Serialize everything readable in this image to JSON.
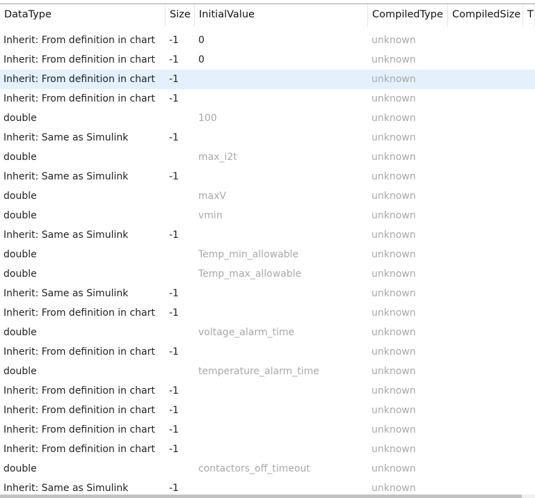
{
  "columns": [
    "DataType",
    "Size",
    "InitialValue",
    "CompiledType",
    "CompiledSize",
    "T"
  ],
  "selected_row": 2,
  "rows": [
    {
      "datatype": "Inherit: From definition in chart",
      "size": "-1",
      "initial": "0",
      "initial_grey": false,
      "compiled": "unknown"
    },
    {
      "datatype": "Inherit: From definition in chart",
      "size": "-1",
      "initial": "0",
      "initial_grey": false,
      "compiled": "unknown"
    },
    {
      "datatype": "Inherit: From definition in chart",
      "size": "-1",
      "initial": "",
      "compiled": "unknown"
    },
    {
      "datatype": "Inherit: From definition in chart",
      "size": "-1",
      "initial": "",
      "compiled": "unknown"
    },
    {
      "datatype": "double",
      "size": "",
      "initial": "100",
      "initial_grey": true,
      "compiled": "unknown"
    },
    {
      "datatype": "Inherit: Same as Simulink",
      "size": "-1",
      "initial": "",
      "compiled": "unknown"
    },
    {
      "datatype": "double",
      "size": "",
      "initial": "max_i2t",
      "initial_grey": true,
      "compiled": "unknown"
    },
    {
      "datatype": "Inherit: Same as Simulink",
      "size": "-1",
      "initial": "",
      "compiled": "unknown"
    },
    {
      "datatype": "double",
      "size": "",
      "initial": "maxV",
      "initial_grey": true,
      "compiled": "unknown"
    },
    {
      "datatype": "double",
      "size": "",
      "initial": "vmin",
      "initial_grey": true,
      "compiled": "unknown"
    },
    {
      "datatype": "Inherit: Same as Simulink",
      "size": "-1",
      "initial": "",
      "compiled": "unknown"
    },
    {
      "datatype": "double",
      "size": "",
      "initial": "Temp_min_allowable",
      "initial_grey": true,
      "compiled": "unknown"
    },
    {
      "datatype": "double",
      "size": "",
      "initial": "Temp_max_allowable",
      "initial_grey": true,
      "compiled": "unknown"
    },
    {
      "datatype": "Inherit: Same as Simulink",
      "size": "-1",
      "initial": "",
      "compiled": "unknown"
    },
    {
      "datatype": "Inherit: From definition in chart",
      "size": "-1",
      "initial": "",
      "compiled": "unknown"
    },
    {
      "datatype": "double",
      "size": "",
      "initial": "voltage_alarm_time",
      "initial_grey": true,
      "compiled": "unknown"
    },
    {
      "datatype": "Inherit: From definition in chart",
      "size": "-1",
      "initial": "",
      "compiled": "unknown"
    },
    {
      "datatype": "double",
      "size": "",
      "initial": "temperature_alarm_time",
      "initial_grey": true,
      "compiled": "unknown"
    },
    {
      "datatype": "Inherit: From definition in chart",
      "size": "-1",
      "initial": "",
      "compiled": "unknown"
    },
    {
      "datatype": "Inherit: From definition in chart",
      "size": "-1",
      "initial": "",
      "compiled": "unknown"
    },
    {
      "datatype": "Inherit: From definition in chart",
      "size": "-1",
      "initial": "",
      "compiled": "unknown"
    },
    {
      "datatype": "Inherit: From definition in chart",
      "size": "-1",
      "initial": "",
      "compiled": "unknown"
    },
    {
      "datatype": "double",
      "size": "",
      "initial": "contactors_off_timeout",
      "initial_grey": true,
      "compiled": "unknown"
    },
    {
      "datatype": "Inherit: Same as Simulink",
      "size": "-1",
      "initial": "",
      "compiled": "unknown"
    }
  ],
  "colors": {
    "selection": "#e3f1fc",
    "muted_text": "#a8a8a8"
  }
}
